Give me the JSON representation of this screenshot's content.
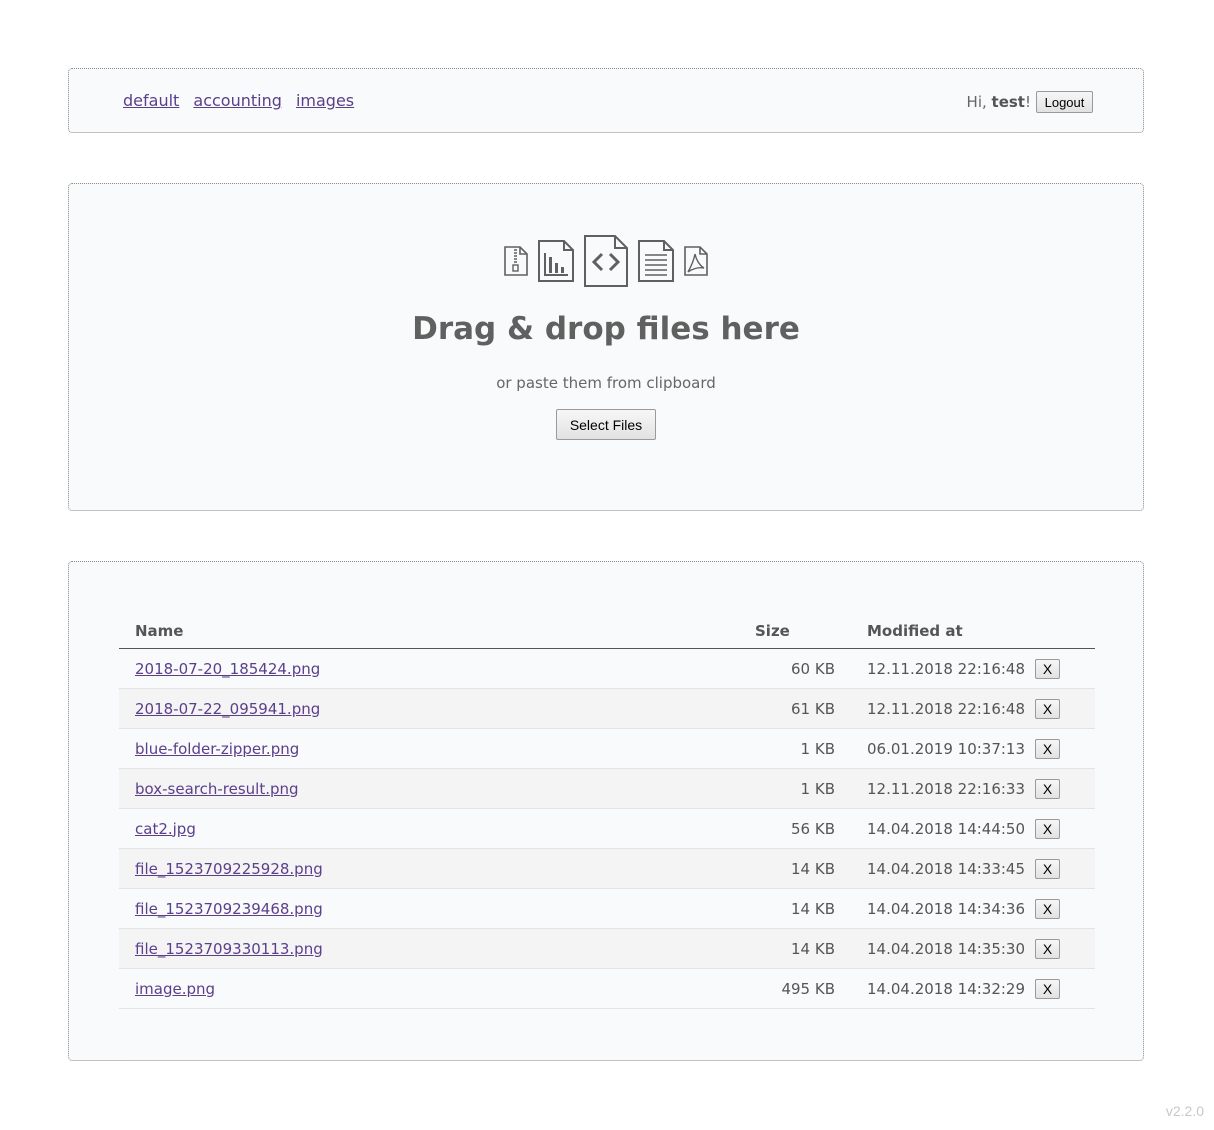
{
  "nav": {
    "links": [
      {
        "label": "default"
      },
      {
        "label": "accounting"
      },
      {
        "label": "images"
      }
    ]
  },
  "user": {
    "greeting": "Hi, ",
    "name": "test",
    "suffix": "!",
    "logout_label": "Logout"
  },
  "dropzone": {
    "icons": [
      "zip-file-icon",
      "chart-file-icon",
      "code-file-icon",
      "text-file-icon",
      "pdf-file-icon"
    ],
    "title": "Drag & drop files here",
    "subtitle": "or paste them from clipboard",
    "select_label": "Select Files"
  },
  "files": {
    "columns": {
      "name": "Name",
      "size": "Size",
      "modified": "Modified at"
    },
    "delete_label": "X",
    "rows": [
      {
        "name": "2018-07-20_185424.png",
        "size": "60 KB",
        "modified": "12.11.2018 22:16:48"
      },
      {
        "name": "2018-07-22_095941.png",
        "size": "61 KB",
        "modified": "12.11.2018 22:16:48"
      },
      {
        "name": "blue-folder-zipper.png",
        "size": "1 KB",
        "modified": "06.01.2019 10:37:13"
      },
      {
        "name": "box-search-result.png",
        "size": "1 KB",
        "modified": "12.11.2018 22:16:33"
      },
      {
        "name": "cat2.jpg",
        "size": "56 KB",
        "modified": "14.04.2018 14:44:50"
      },
      {
        "name": "file_1523709225928.png",
        "size": "14 KB",
        "modified": "14.04.2018 14:33:45"
      },
      {
        "name": "file_1523709239468.png",
        "size": "14 KB",
        "modified": "14.04.2018 14:34:36"
      },
      {
        "name": "file_1523709330113.png",
        "size": "14 KB",
        "modified": "14.04.2018 14:35:30"
      },
      {
        "name": "image.png",
        "size": "495 KB",
        "modified": "14.04.2018 14:32:29"
      }
    ]
  },
  "version": "v2.2.0",
  "colors": {
    "link": "#5b3f8a",
    "panel_bg": "#f9fafb",
    "text": "#555555"
  }
}
